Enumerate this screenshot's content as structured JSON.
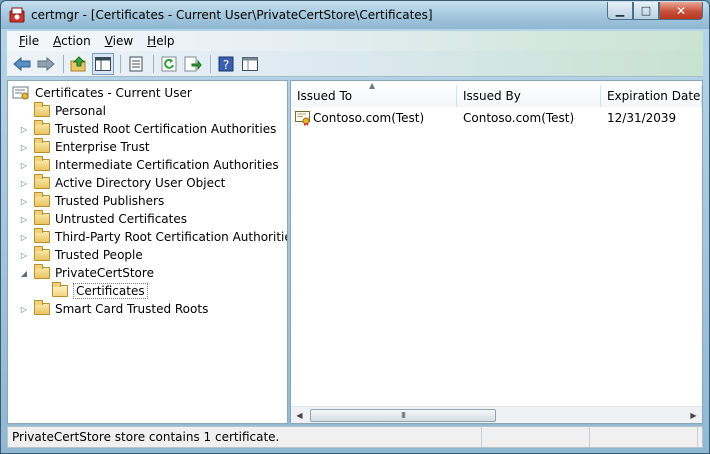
{
  "window": {
    "title": "certmgr - [Certificates - Current User\\PrivateCertStore\\Certificates]"
  },
  "caption_buttons": {
    "minimize": "▁",
    "maximize": "□",
    "close": "✕"
  },
  "menu": {
    "items": [
      {
        "accel": "F",
        "rest": "ile"
      },
      {
        "accel": "A",
        "rest": "ction"
      },
      {
        "accel": "V",
        "rest": "iew"
      },
      {
        "accel": "H",
        "rest": "elp"
      }
    ]
  },
  "toolbar": {
    "buttons": [
      "back-icon",
      "forward-icon",
      "up-folder-icon",
      "show-hide-tree-icon",
      "properties-icon",
      "refresh-icon",
      "export-list-icon",
      "help-icon",
      "console-tree-icon"
    ]
  },
  "tree": {
    "root_label": "Certificates - Current User",
    "items": [
      {
        "label": "Personal",
        "expander": ""
      },
      {
        "label": "Trusted Root Certification Authorities",
        "expander": "▷"
      },
      {
        "label": "Enterprise Trust",
        "expander": "▷"
      },
      {
        "label": "Intermediate Certification Authorities",
        "expander": "▷"
      },
      {
        "label": "Active Directory User Object",
        "expander": "▷"
      },
      {
        "label": "Trusted Publishers",
        "expander": "▷"
      },
      {
        "label": "Untrusted Certificates",
        "expander": "▷"
      },
      {
        "label": "Third-Party Root Certification Authorities",
        "expander": "▷"
      },
      {
        "label": "Trusted People",
        "expander": "▷"
      },
      {
        "label": "PrivateCertStore",
        "expander": "◢"
      },
      {
        "label": "Certificates",
        "expander": "",
        "child": true,
        "selected": true
      },
      {
        "label": "Smart Card Trusted Roots",
        "expander": "▷"
      }
    ]
  },
  "list": {
    "columns": [
      "Issued To",
      "Issued By",
      "Expiration Date"
    ],
    "sort_arrow": "▲",
    "rows": [
      {
        "issued_to": "Contoso.com(Test)",
        "issued_by": "Contoso.com(Test)",
        "expiration": "12/31/2039"
      }
    ]
  },
  "scrollbar": {
    "left_arrow": "◀",
    "right_arrow": "▶",
    "grip": "III"
  },
  "status": {
    "text": "PrivateCertStore store contains 1 certificate."
  }
}
